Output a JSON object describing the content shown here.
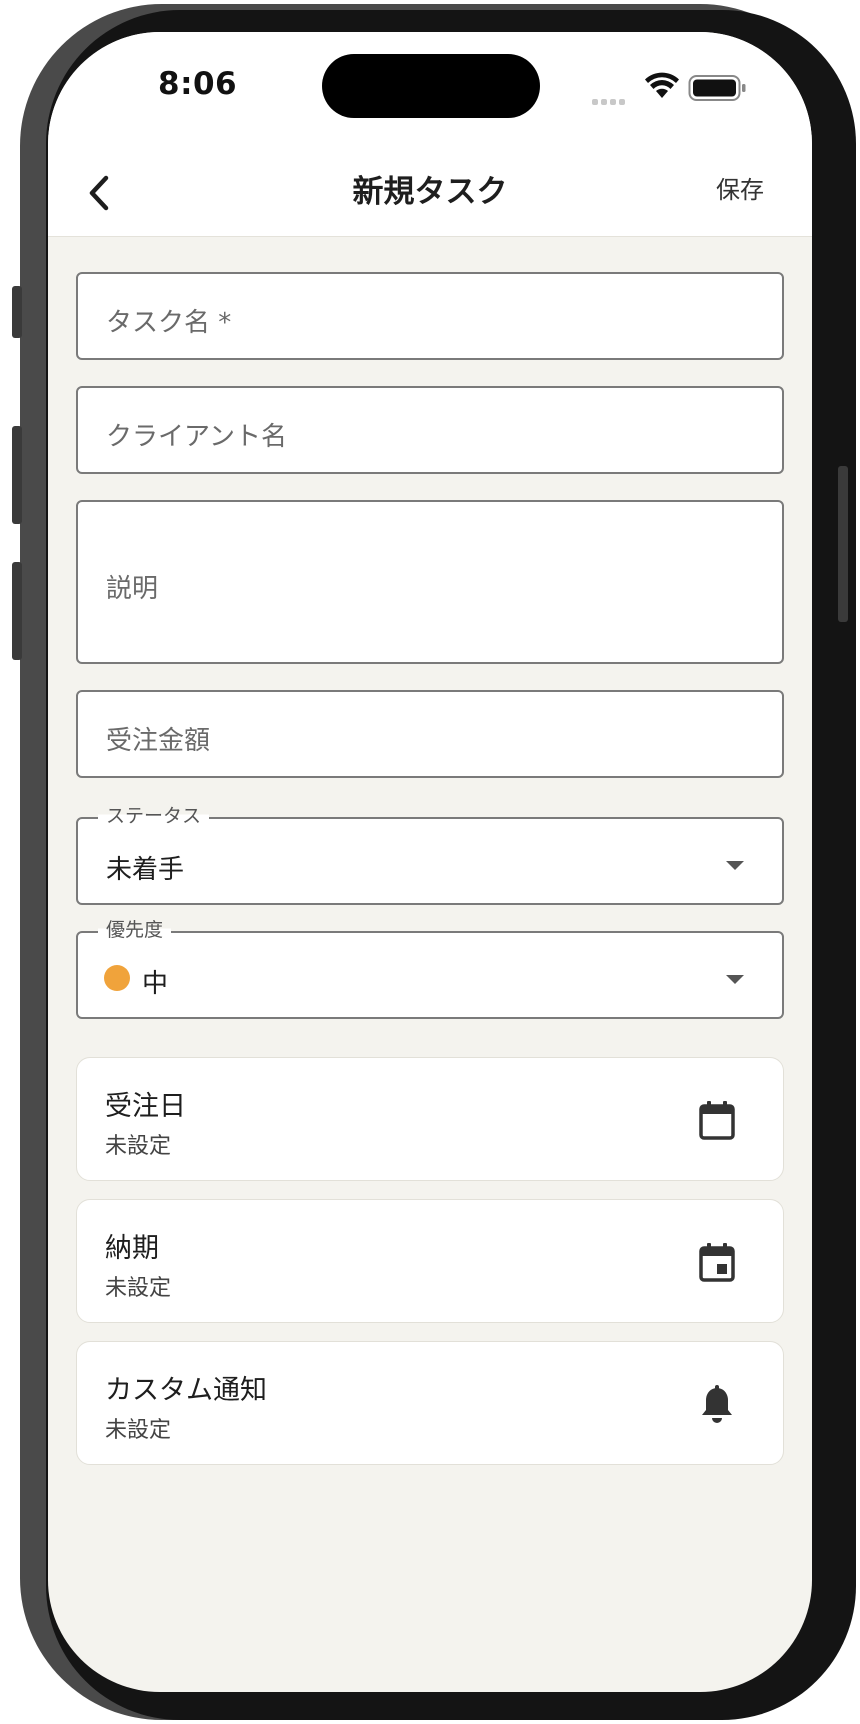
{
  "status_bar": {
    "time": "8:06"
  },
  "header": {
    "title": "新規タスク",
    "save_label": "保存"
  },
  "form": {
    "task_name_placeholder": "タスク名 *",
    "client_name_placeholder": "クライアント名",
    "description_placeholder": "説明",
    "order_amount_placeholder": "受注金額",
    "status": {
      "label": "ステータス",
      "value": "未着手"
    },
    "priority": {
      "label": "優先度",
      "value": "中",
      "color": "#f0a33b"
    }
  },
  "cards": [
    {
      "label": "受注日",
      "value": "未設定",
      "icon": "calendar-icon"
    },
    {
      "label": "納期",
      "value": "未設定",
      "icon": "event-icon"
    },
    {
      "label": "カスタム通知",
      "value": "未設定",
      "icon": "bell-icon"
    }
  ]
}
